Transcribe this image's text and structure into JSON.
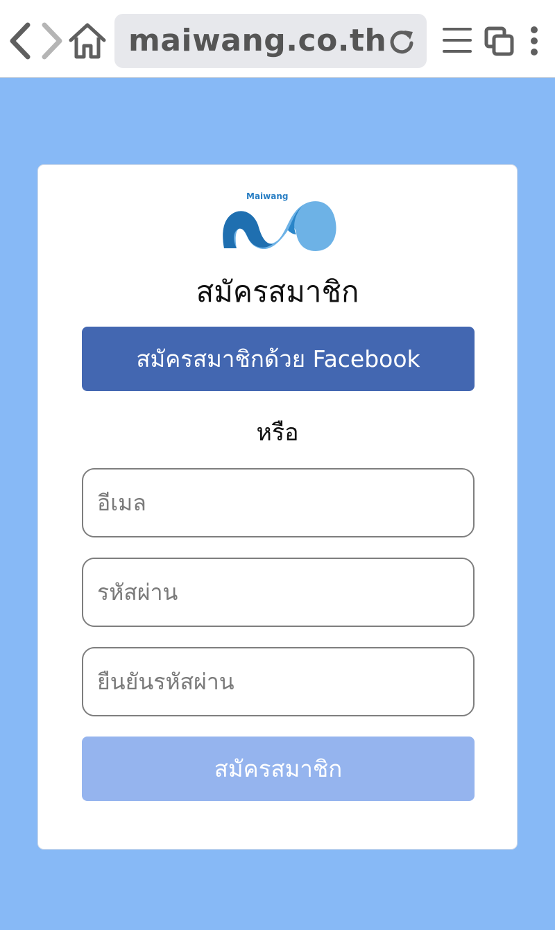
{
  "browser": {
    "url": "maiwang.co.th",
    "icons": [
      "back-icon",
      "forward-icon",
      "home-icon",
      "reload-icon",
      "menu-icon",
      "tabs-icon",
      "more-icon"
    ]
  },
  "colors": {
    "page_bg": "#87b9f6",
    "facebook_button": "#4367b1",
    "submit_button_disabled": "#95b4ee"
  },
  "card": {
    "logo_text": "Maiwang",
    "title": "สมัครสมาชิก",
    "facebook_button": "สมัครสมาชิกด้วย Facebook",
    "divider_text": "หรือ",
    "fields": {
      "email": {
        "placeholder": "อีเมล",
        "value": ""
      },
      "password": {
        "placeholder": "รหัสผ่าน",
        "value": ""
      },
      "confirm_password": {
        "placeholder": "ยืนยันรหัสผ่าน",
        "value": ""
      }
    },
    "submit_button": "สมัครสมาชิก"
  }
}
